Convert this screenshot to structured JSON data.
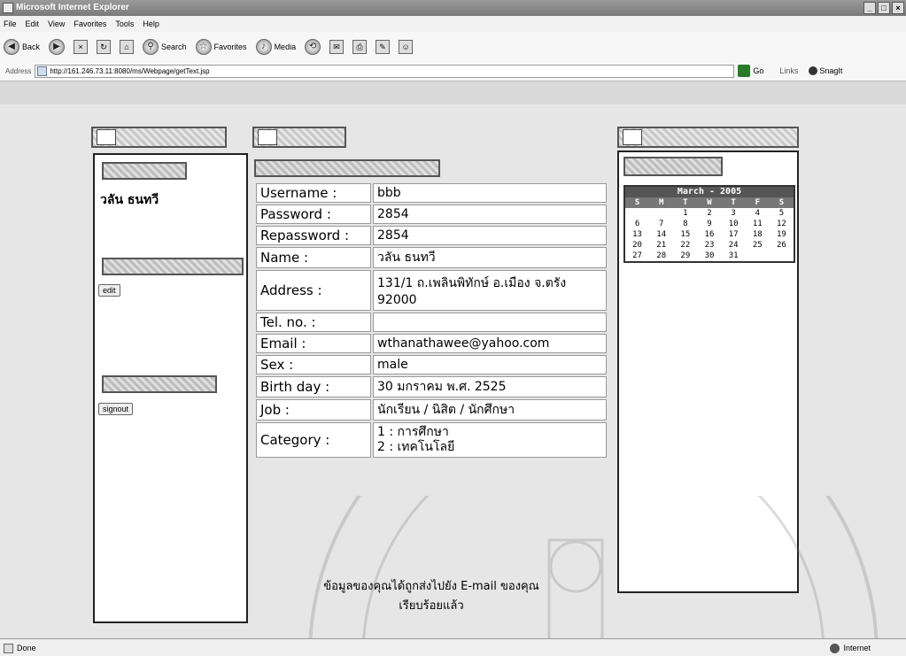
{
  "window": {
    "title": "Microsoft Internet Explorer",
    "min": "_",
    "max": "□",
    "close": "×"
  },
  "menu": [
    "File",
    "Edit",
    "View",
    "Favorites",
    "Tools",
    "Help"
  ],
  "toolbar": {
    "back": "Back",
    "search": "Search",
    "favorites": "Favorites",
    "media": "Media"
  },
  "address": {
    "label": "Address",
    "url": "http://161.246.73.11:8080/ms/Webpage/getText.jsp",
    "go": "Go",
    "links": "Links",
    "snagit": "SnagIt"
  },
  "sidebar": {
    "user_name": "วลัน ธนทวี",
    "edit_button": "edit",
    "signout_button": "signout"
  },
  "form": {
    "rows": [
      {
        "label": "Username :",
        "value": "bbb"
      },
      {
        "label": "Password :",
        "value": "2854"
      },
      {
        "label": "Repassword :",
        "value": "2854"
      },
      {
        "label": "Name :",
        "value": "วลัน ธนทวี"
      },
      {
        "label": "Address :",
        "value": "131/1 ถ.เพลินพิทักษ์ อ.เมือง จ.ตรัง 92000"
      },
      {
        "label": "Tel. no. :",
        "value": ""
      },
      {
        "label": "Email :",
        "value": "wthanathawee@yahoo.com"
      },
      {
        "label": "Sex :",
        "value": "male"
      },
      {
        "label": "Birth day :",
        "value": "30 มกราคม พ.ศ. 2525"
      },
      {
        "label": "Job :",
        "value": "นักเรียน / นิสิต / นักศึกษา"
      },
      {
        "label": "Category :",
        "value": "1 : การศึกษา\n2 : เทคโนโลยี"
      }
    ],
    "notice_line1": "ข้อมูลของคุณได้ถูกส่งไปยัง E-mail ของคุณ",
    "notice_line2": "เรียบร้อยแล้ว"
  },
  "calendar": {
    "title": "March - 2005",
    "day_names": [
      "S",
      "M",
      "T",
      "W",
      "T",
      "F",
      "S"
    ],
    "weeks": [
      [
        "",
        "",
        "1",
        "2",
        "3",
        "4",
        "5"
      ],
      [
        "6",
        "7",
        "8",
        "9",
        "10",
        "11",
        "12"
      ],
      [
        "13",
        "14",
        "15",
        "16",
        "17",
        "18",
        "19"
      ],
      [
        "20",
        "21",
        "22",
        "23",
        "24",
        "25",
        "26"
      ],
      [
        "27",
        "28",
        "29",
        "30",
        "31",
        "",
        ""
      ]
    ]
  },
  "status": {
    "left": "Done",
    "right": "Internet"
  }
}
